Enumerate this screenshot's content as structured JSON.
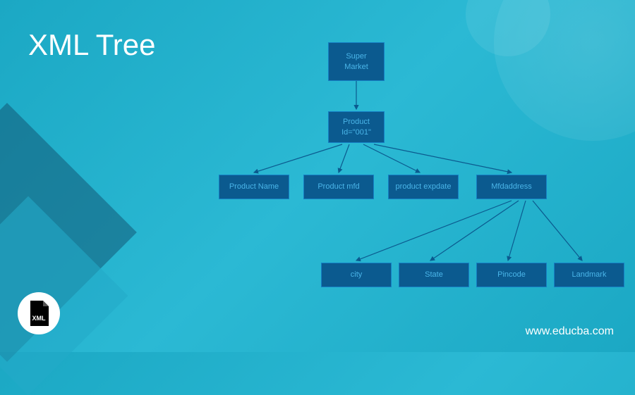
{
  "title": "XML Tree",
  "website": "www.educba.com",
  "icon_label": "XML",
  "tree": {
    "root": {
      "line1": "Super",
      "line2": "Market"
    },
    "level1": {
      "line1": "Product",
      "line2": "Id=\"001\""
    },
    "level2": [
      {
        "label": "Product Name"
      },
      {
        "label": "Product mfd"
      },
      {
        "label": "product expdate"
      },
      {
        "label": "Mfdaddress"
      }
    ],
    "level3": [
      {
        "label": "city"
      },
      {
        "label": "State"
      },
      {
        "label": "Pincode"
      },
      {
        "label": "Landmark"
      }
    ]
  }
}
